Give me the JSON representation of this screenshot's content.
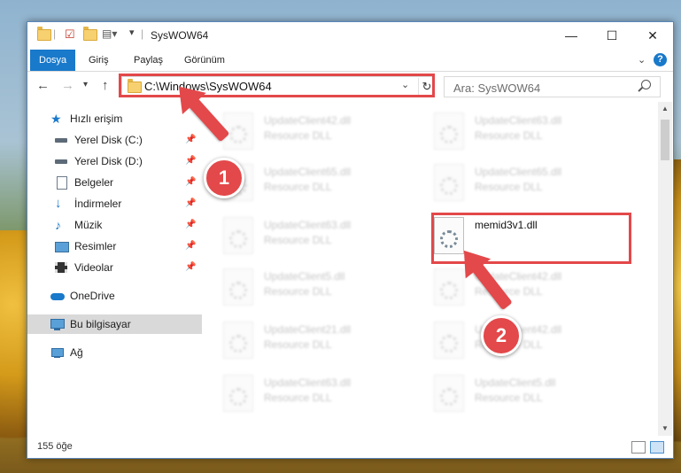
{
  "window": {
    "title": "SysWOW64",
    "minimize_label": "—",
    "maximize_label": "☐",
    "close_label": "✕"
  },
  "ribbon": {
    "tabs": [
      {
        "label": "Dosya",
        "active": true
      },
      {
        "label": "Giriş"
      },
      {
        "label": "Paylaş"
      },
      {
        "label": "Görünüm"
      }
    ],
    "help_label": "?"
  },
  "address": {
    "path": "C:\\Windows\\SysWOW64",
    "search_placeholder": "Ara: SysWOW64"
  },
  "sidebar": {
    "items": [
      {
        "label": "Hızlı erişim",
        "icon": "star-icon"
      },
      {
        "label": "Yerel Disk (C:)",
        "icon": "drive-icon",
        "pinned": true
      },
      {
        "label": "Yerel Disk (D:)",
        "icon": "drive-icon",
        "pinned": true
      },
      {
        "label": "Belgeler",
        "icon": "document-icon",
        "pinned": true
      },
      {
        "label": "İndirmeler",
        "icon": "download-icon",
        "pinned": true
      },
      {
        "label": "Müzik",
        "icon": "music-icon",
        "pinned": true
      },
      {
        "label": "Resimler",
        "icon": "pictures-icon",
        "pinned": true
      },
      {
        "label": "Videolar",
        "icon": "video-icon",
        "pinned": true
      },
      {
        "label": "OneDrive",
        "icon": "cloud-icon"
      },
      {
        "label": "Bu bilgisayar",
        "icon": "computer-icon",
        "selected": true
      },
      {
        "label": "Ağ",
        "icon": "network-icon"
      }
    ]
  },
  "files": [
    {
      "name": "UpdateClient42.dll",
      "type": "Resource DLL"
    },
    {
      "name": "UpdateClient63.dll",
      "type": "Resource DLL"
    },
    {
      "name": "UpdateClient65.dll",
      "type": "Resource DLL"
    },
    {
      "name": "UpdateClient65.dll",
      "type": "Resource DLL"
    },
    {
      "name": "UpdateClient63.dll",
      "type": "Resource DLL"
    },
    {
      "name": "memid3v1.dll",
      "type": "",
      "highlighted": true
    },
    {
      "name": "UpdateClient5.dll",
      "type": "Resource DLL"
    },
    {
      "name": "UpdateClient42.dll",
      "type": "Resource DLL"
    },
    {
      "name": "UpdateClient21.dll",
      "type": "Resource DLL"
    },
    {
      "name": "UpdateClient42.dll",
      "type": "Resource DLL"
    },
    {
      "name": "UpdateClient63.dll",
      "type": "Resource DLL"
    },
    {
      "name": "UpdateClient5.dll",
      "type": "Resource DLL"
    }
  ],
  "status": {
    "item_count": "155 öğe"
  },
  "annotations": {
    "step1": "1",
    "step2": "2",
    "color": "#e3484a"
  }
}
